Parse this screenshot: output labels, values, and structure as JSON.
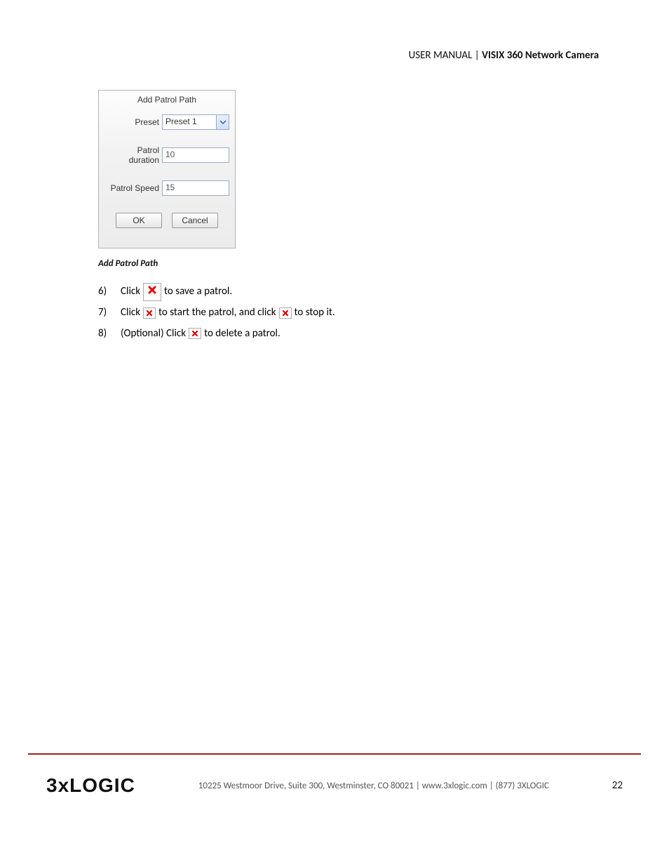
{
  "header": {
    "prefix": "USER MANUAL | ",
    "title": "VISIX 360 Network Camera"
  },
  "dialog": {
    "title": "Add Patrol Path",
    "preset_label": "Preset",
    "preset_value": "Preset 1",
    "duration_label": "Patrol duration",
    "duration_value": "10",
    "speed_label": "Patrol Speed",
    "speed_value": "15",
    "ok_label": "OK",
    "cancel_label": "Cancel"
  },
  "caption": "Add Patrol Path",
  "steps": {
    "s6": {
      "num": "6)",
      "t1": "Click",
      "t2": "to save a patrol."
    },
    "s7": {
      "num": "7)",
      "t1": "Click",
      "t2": "to start the patrol, and click",
      "t3": "to stop it."
    },
    "s8": {
      "num": "8)",
      "t1": "(Optional) Click",
      "t2": "to delete a patrol."
    }
  },
  "footer": {
    "logo": "3xLOGIC",
    "text": "10225 Westmoor Drive, Suite 300, Westminster, CO 80021 | www.3xlogic.com | (877) 3XLOGIC",
    "page": "22"
  }
}
